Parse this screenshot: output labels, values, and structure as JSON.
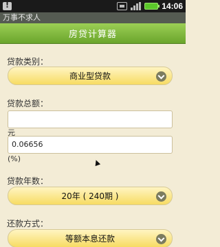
{
  "status_bar": {
    "time": "14:06",
    "icons": [
      "notification-icon",
      "usb-icon",
      "signal-icon",
      "battery-icon"
    ]
  },
  "app_title": "万事不求人",
  "header": {
    "title": "房贷计算器"
  },
  "form": {
    "loan_type": {
      "label": "贷款类别：",
      "selected": "商业型贷款"
    },
    "loan_amount": {
      "label": "贷款总额：",
      "value": "",
      "unit": "元"
    },
    "rate": {
      "value": "0.06656",
      "unit": "(%)"
    },
    "loan_term": {
      "label": "贷款年数：",
      "selected": "20年 ( 240期 )"
    },
    "repayment": {
      "label": "还款方式：",
      "selected": "等额本息还款"
    }
  },
  "colors": {
    "header_green": "#7db83a",
    "select_yellow": "#f7dc63",
    "background": "#f3ecd6"
  }
}
